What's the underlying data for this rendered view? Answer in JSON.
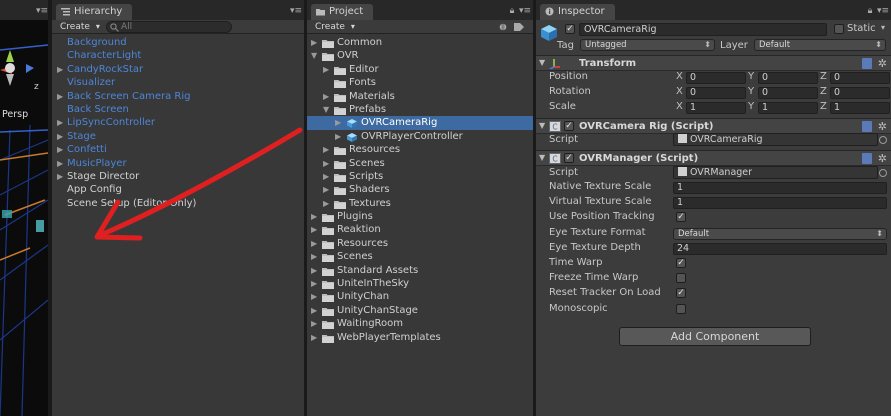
{
  "scene": {
    "persp_label": "Persp",
    "axis_labels": {
      "z": "z"
    }
  },
  "hierarchy": {
    "tab_label": "Hierarchy",
    "create_label": "Create",
    "search_placeholder": "All",
    "items": [
      {
        "label": "Background",
        "color": "blue",
        "arrow": false
      },
      {
        "label": "CharacterLight",
        "color": "blue",
        "arrow": false
      },
      {
        "label": "CandyRockStar",
        "color": "blue",
        "arrow": true
      },
      {
        "label": "Visualizer",
        "color": "blue",
        "arrow": false
      },
      {
        "label": "Back Screen Camera Rig",
        "color": "blue",
        "arrow": true
      },
      {
        "label": "Back Screen",
        "color": "blue",
        "arrow": false
      },
      {
        "label": "LipSyncController",
        "color": "blue",
        "arrow": true
      },
      {
        "label": "Stage",
        "color": "blue",
        "arrow": true
      },
      {
        "label": "Confetti",
        "color": "blue",
        "arrow": true
      },
      {
        "label": "MusicPlayer",
        "color": "blue",
        "arrow": true
      },
      {
        "label": "Stage Director",
        "color": "white",
        "arrow": true
      },
      {
        "label": "App Config",
        "color": "white",
        "arrow": false
      },
      {
        "label": "Scene Setup (Editor Only)",
        "color": "white",
        "arrow": false
      }
    ]
  },
  "project": {
    "tab_label": "Project",
    "create_label": "Create",
    "items": [
      {
        "label": "Common",
        "depth": 0,
        "arrow": "right",
        "icon": "folder",
        "selected": false
      },
      {
        "label": "OVR",
        "depth": 0,
        "arrow": "down",
        "icon": "folder",
        "selected": false
      },
      {
        "label": "Editor",
        "depth": 1,
        "arrow": "right",
        "icon": "folder",
        "selected": false
      },
      {
        "label": "Fonts",
        "depth": 1,
        "arrow": "none",
        "icon": "folder",
        "selected": false
      },
      {
        "label": "Materials",
        "depth": 1,
        "arrow": "right",
        "icon": "folder",
        "selected": false
      },
      {
        "label": "Prefabs",
        "depth": 1,
        "arrow": "down",
        "icon": "folder",
        "selected": false
      },
      {
        "label": "OVRCameraRig",
        "depth": 2,
        "arrow": "right",
        "icon": "prefab",
        "selected": true
      },
      {
        "label": "OVRPlayerController",
        "depth": 2,
        "arrow": "right",
        "icon": "prefab",
        "selected": false
      },
      {
        "label": "Resources",
        "depth": 1,
        "arrow": "right",
        "icon": "folder",
        "selected": false
      },
      {
        "label": "Scenes",
        "depth": 1,
        "arrow": "right",
        "icon": "folder",
        "selected": false
      },
      {
        "label": "Scripts",
        "depth": 1,
        "arrow": "right",
        "icon": "folder",
        "selected": false
      },
      {
        "label": "Shaders",
        "depth": 1,
        "arrow": "right",
        "icon": "folder",
        "selected": false
      },
      {
        "label": "Textures",
        "depth": 1,
        "arrow": "right",
        "icon": "folder",
        "selected": false
      },
      {
        "label": "Plugins",
        "depth": 0,
        "arrow": "right",
        "icon": "folder",
        "selected": false
      },
      {
        "label": "Reaktion",
        "depth": 0,
        "arrow": "right",
        "icon": "folder",
        "selected": false
      },
      {
        "label": "Resources",
        "depth": 0,
        "arrow": "right",
        "icon": "folder",
        "selected": false
      },
      {
        "label": "Scenes",
        "depth": 0,
        "arrow": "right",
        "icon": "folder",
        "selected": false
      },
      {
        "label": "Standard Assets",
        "depth": 0,
        "arrow": "right",
        "icon": "folder",
        "selected": false
      },
      {
        "label": "UniteInTheSky",
        "depth": 0,
        "arrow": "right",
        "icon": "folder",
        "selected": false
      },
      {
        "label": "UnityChan",
        "depth": 0,
        "arrow": "right",
        "icon": "folder",
        "selected": false
      },
      {
        "label": "UnityChanStage",
        "depth": 0,
        "arrow": "right",
        "icon": "folder",
        "selected": false
      },
      {
        "label": "WaitingRoom",
        "depth": 0,
        "arrow": "right",
        "icon": "folder",
        "selected": false
      },
      {
        "label": "WebPlayerTemplates",
        "depth": 0,
        "arrow": "right",
        "icon": "folder",
        "selected": false
      }
    ]
  },
  "inspector": {
    "tab_label": "Inspector",
    "object_name": "OVRCameraRig",
    "active_checked": true,
    "static_label": "Static",
    "static_checked": false,
    "tag_label": "Tag",
    "tag_value": "Untagged",
    "layer_label": "Layer",
    "layer_value": "Default",
    "transform": {
      "title": "Transform",
      "rows": [
        {
          "label": "Position",
          "x": "0",
          "y": "0",
          "z": "0"
        },
        {
          "label": "Rotation",
          "x": "0",
          "y": "0",
          "z": "0"
        },
        {
          "label": "Scale",
          "x": "1",
          "y": "1",
          "z": "1"
        }
      ],
      "axis_x": "X",
      "axis_y": "Y",
      "axis_z": "Z"
    },
    "camera_rig": {
      "title": "OVRCamera Rig (Script)",
      "script_label": "Script",
      "script_value": "OVRCameraRig"
    },
    "manager": {
      "title": "OVRManager (Script)",
      "script_label": "Script",
      "script_value": "OVRManager",
      "fields": [
        {
          "label": "Native Texture Scale",
          "type": "number",
          "value": "1"
        },
        {
          "label": "Virtual Texture Scale",
          "type": "number",
          "value": "1"
        },
        {
          "label": "Use Position Tracking",
          "type": "toggle",
          "checked": true
        },
        {
          "label": "Eye Texture Format",
          "type": "enum",
          "value": "Default"
        },
        {
          "label": "Eye Texture Depth",
          "type": "number",
          "value": "24"
        },
        {
          "label": "Time Warp",
          "type": "toggle",
          "checked": true
        },
        {
          "label": "Freeze Time Warp",
          "type": "toggle",
          "checked": false
        },
        {
          "label": "Reset Tracker On Load",
          "type": "toggle",
          "checked": true
        },
        {
          "label": "Monoscopic",
          "type": "toggle",
          "checked": false
        }
      ]
    },
    "add_component_label": "Add Component"
  },
  "colors": {
    "selection": "#3d6aa0",
    "prefab_blue": "#4d86d8",
    "annotation_red": "#e02020"
  }
}
